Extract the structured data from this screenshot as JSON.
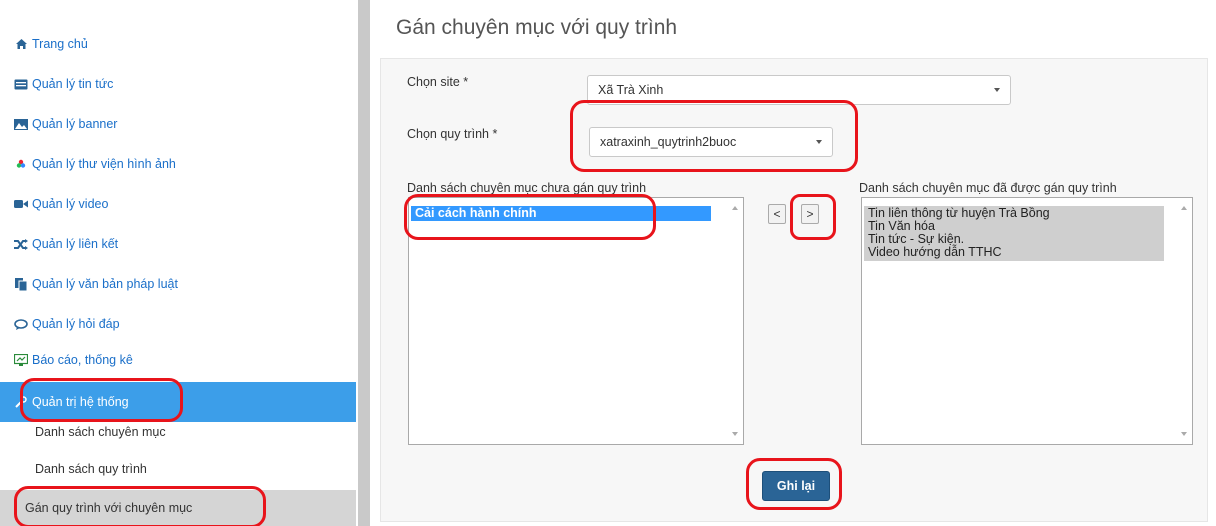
{
  "sidebar": {
    "items": [
      {
        "label": "Trang chủ",
        "icon": "home-icon"
      },
      {
        "label": "Quản lý tin tức",
        "icon": "news-icon"
      },
      {
        "label": "Quản lý banner",
        "icon": "image-icon"
      },
      {
        "label": "Quản lý thư viện hình ảnh",
        "icon": "gallery-icon"
      },
      {
        "label": "Quản lý video",
        "icon": "video-icon"
      },
      {
        "label": "Quản lý liên kết",
        "icon": "shuffle-icon"
      },
      {
        "label": "Quản lý văn bản pháp luật",
        "icon": "document-icon"
      },
      {
        "label": "Quản lý hỏi đáp",
        "icon": "chat-icon"
      },
      {
        "label": "Báo cáo, thống kê",
        "icon": "report-icon"
      },
      {
        "label": "Quản trị hệ thống",
        "icon": "wrench-icon"
      }
    ],
    "subitems": [
      {
        "label": "Danh sách chuyên mục"
      },
      {
        "label": "Danh sách quy trình"
      },
      {
        "label": "Gán quy trình với chuyên mục"
      }
    ]
  },
  "main": {
    "title": "Gán chuyên mục với quy trình",
    "site_label": "Chọn site *",
    "site_value": "Xã Trà Xinh",
    "process_label": "Chọn quy trình *",
    "process_value": "xatraxinh_quytrinh2buoc",
    "left_list_label": "Danh sách chuyên mục chưa gán quy trình",
    "left_list_items": [
      "Cải cách hành chính"
    ],
    "right_list_label": "Danh sách chuyên mục đã được gán quy trình",
    "right_list_items": [
      "Tin liên thông từ huyện Trà Bồng",
      "Tin Văn hóa",
      "Tin tức - Sự kiện.",
      "Video hướng dẫn TTHC"
    ],
    "move_left_label": "<",
    "move_right_label": ">",
    "save_label": "Ghi lại"
  },
  "colors": {
    "accent": "#3c9ee9",
    "link": "#1a6fc9",
    "save_button": "#2a6496",
    "highlight": "#e8141b"
  }
}
